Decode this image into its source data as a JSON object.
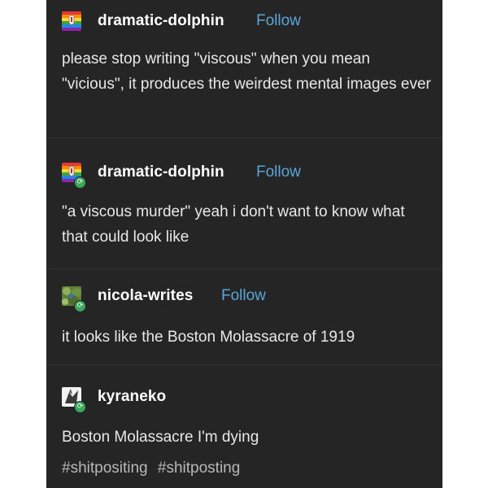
{
  "posts": [
    {
      "username": "dramatic-dolphin",
      "follow_label": "Follow",
      "text": "please stop writing \"viscous\" when you mean \"vicious\", it produces the weirdest mental images ever"
    },
    {
      "username": "dramatic-dolphin",
      "follow_label": "Follow",
      "text": "\"a viscous murder\" yeah i don't want to know what that could look like"
    },
    {
      "username": "nicola-writes",
      "follow_label": "Follow",
      "text": "it looks like the Boston Molassacre of 1919"
    },
    {
      "username": "kyraneko",
      "text": "Boston Molassacre I'm dying",
      "tags": [
        "#shitpositing",
        "#shitposting"
      ]
    }
  ],
  "colors": {
    "background": "#252525",
    "follow": "#5aa6d9",
    "reblog_badge": "#3aa85c"
  },
  "icons": {
    "reblog_badge": "reblog-icon"
  }
}
